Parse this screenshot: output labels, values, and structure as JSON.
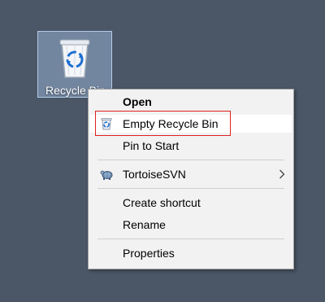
{
  "desktop": {
    "recycle_bin_label": "Recycle Bin"
  },
  "context_menu": {
    "open_label": "Open",
    "empty_recycle_bin_label": "Empty Recycle Bin",
    "pin_to_start_label": "Pin to Start",
    "tortoisesvn_label": "TortoiseSVN",
    "create_shortcut_label": "Create shortcut",
    "rename_label": "Rename",
    "properties_label": "Properties"
  },
  "colors": {
    "desktop_background": "#4b5666",
    "menu_background": "#f2f2f2",
    "highlight_outline": "#e02020"
  },
  "icons": {
    "recycle_bin": "recycle-bin-icon",
    "empty_bin": "recycle-bin-small-icon",
    "tortoisesvn": "tortoisesvn-icon",
    "submenu": "chevron-right-icon"
  }
}
